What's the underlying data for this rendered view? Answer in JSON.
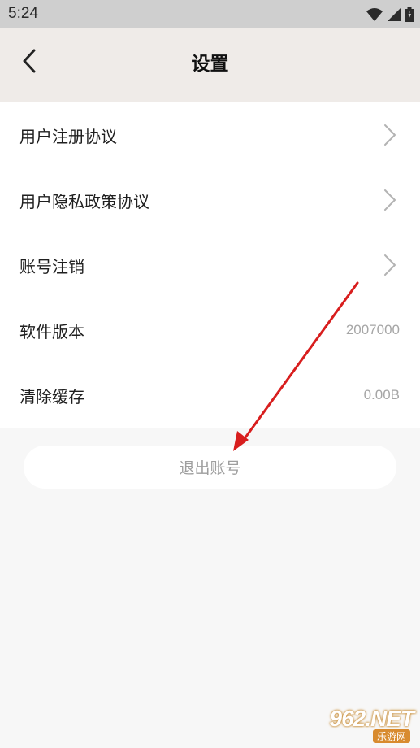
{
  "status_bar": {
    "time": "5:24"
  },
  "header": {
    "title": "设置"
  },
  "settings": [
    {
      "label": "用户注册协议",
      "type": "link"
    },
    {
      "label": "用户隐私政策协议",
      "type": "link"
    },
    {
      "label": "账号注销",
      "type": "link"
    },
    {
      "label": "软件版本",
      "value": "2007000"
    },
    {
      "label": "清除缓存",
      "value": "0.00B"
    }
  ],
  "logout": {
    "label": "退出账号"
  },
  "watermark": {
    "main": "962.NET",
    "sub": "乐游网"
  },
  "colors": {
    "status_bar": "#cfcfcf",
    "header_bg": "#efebe8",
    "page_bg": "#f7f7f7",
    "list_bg": "#ffffff",
    "annotation_arrow": "#d81e1e"
  }
}
